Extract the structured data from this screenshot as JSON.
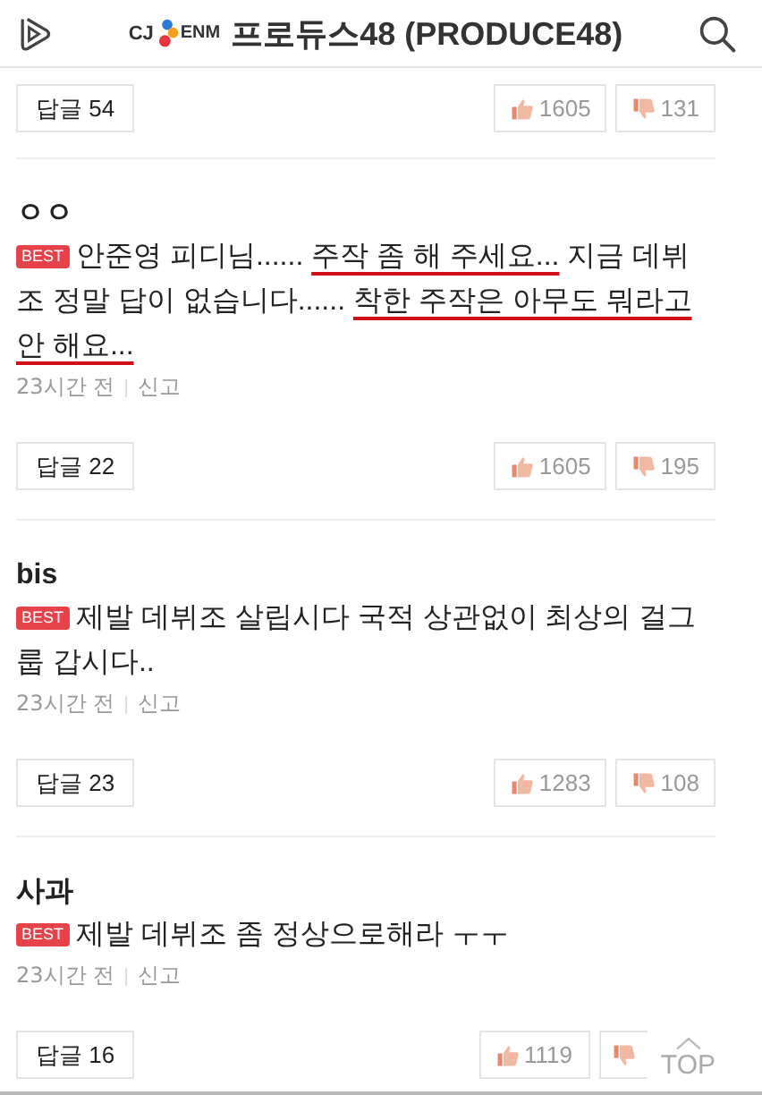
{
  "header": {
    "logo_left": "CJ",
    "logo_right": "ENM",
    "title": "프로듀스48 (PRODUCE48)"
  },
  "comments": [
    {
      "replies": "답글 54",
      "likes": "1605",
      "dislikes": "131"
    },
    {
      "author": "ㅇㅇ",
      "best": "BEST",
      "segments": [
        {
          "text": "안준영 피디님...... ",
          "underlined": false
        },
        {
          "text": "주작 좀 해 주세요...",
          "underlined": true
        },
        {
          "text": " 지금 데뷔조 정말 답이 없습니다...... ",
          "underlined": false
        },
        {
          "text": "착한 주작은 아무도 뭐라고 안 해요...",
          "underlined": true
        }
      ],
      "time": "23시간 전",
      "report": "신고",
      "replies": "답글 22",
      "likes": "1605",
      "dislikes": "195"
    },
    {
      "author": "bis",
      "best": "BEST",
      "segments": [
        {
          "text": "제발 데뷔조 살립시다 국적 상관없이 최상의 걸그룹 갑시다..",
          "underlined": false
        }
      ],
      "time": "23시간 전",
      "report": "신고",
      "replies": "답글 23",
      "likes": "1283",
      "dislikes": "108"
    },
    {
      "author": "사과",
      "best": "BEST",
      "segments": [
        {
          "text": "제발 데뷔조 좀 정상으로해라 ㅜㅜ",
          "underlined": false
        }
      ],
      "time": "23시간 전",
      "report": "신고",
      "replies": "답글 16",
      "likes": "1119"
    }
  ],
  "top_button": "TOP"
}
